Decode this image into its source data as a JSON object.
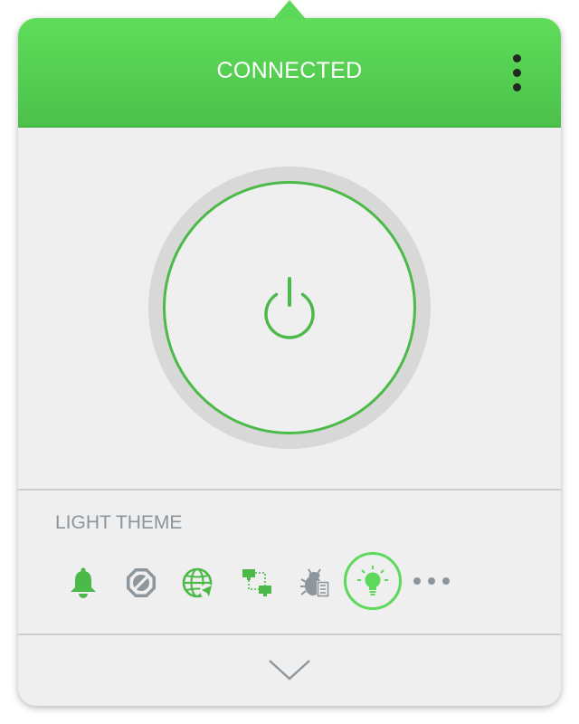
{
  "header": {
    "status": "CONNECTED",
    "menu_icon": "vertical-dots-icon"
  },
  "power": {
    "icon": "power-icon",
    "state": "on"
  },
  "theme": {
    "label": "LIGHT THEME"
  },
  "features": [
    {
      "icon": "bell-icon",
      "color": "#4cba48"
    },
    {
      "icon": "block-icon",
      "color": "#8d969d"
    },
    {
      "icon": "globe-icon",
      "color": "#4cba48"
    },
    {
      "icon": "network-icon",
      "color": "#4cba48"
    },
    {
      "icon": "bug-icon",
      "color": "#8d969d"
    },
    {
      "icon": "lightbulb-icon",
      "color": "#5cd95a",
      "active": true
    }
  ],
  "more_icon": "horizontal-dots-icon",
  "collapse_icon": "chevron-down-icon",
  "colors": {
    "accent": "#5cd95a",
    "accent_dark": "#4cba48",
    "panel": "#efefef",
    "muted": "#8d969d"
  }
}
